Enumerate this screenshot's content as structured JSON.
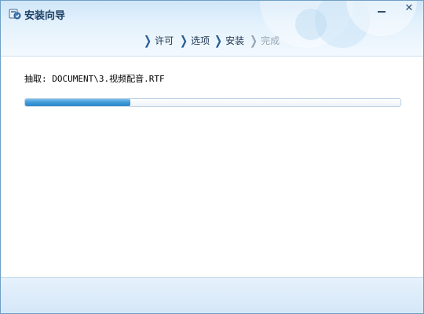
{
  "window": {
    "title": "安装向导",
    "icon": "installer-icon"
  },
  "controls": {
    "minimize_icon": "minimize-icon",
    "close_label": "✕"
  },
  "steps": [
    {
      "label": "许可",
      "state": "done"
    },
    {
      "label": "选项",
      "state": "done"
    },
    {
      "label": "安装",
      "state": "active"
    },
    {
      "label": "完成",
      "state": "disabled"
    }
  ],
  "chevron": "❯",
  "extract": {
    "text": "抽取: DOCUMENT\\3.视频配音.RTF"
  },
  "progress": {
    "fraction": 0.28,
    "fill_color": "#3f9ad8"
  }
}
